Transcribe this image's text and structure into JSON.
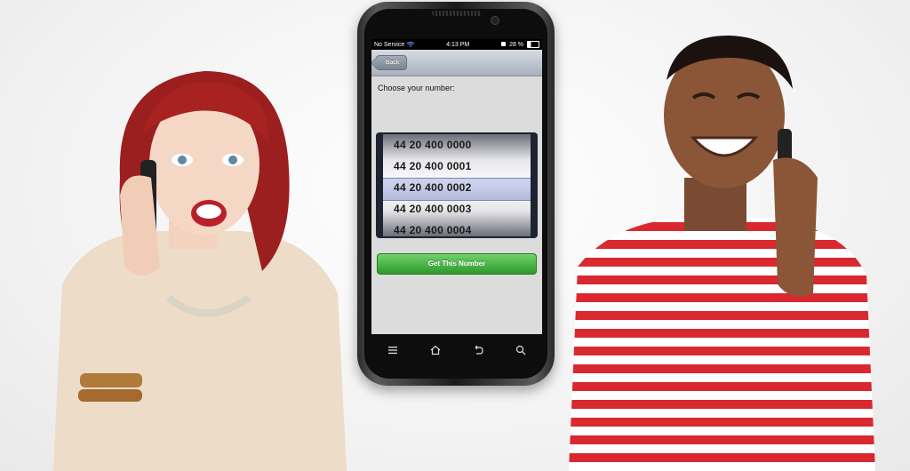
{
  "status_bar": {
    "carrier": "No Service",
    "time": "4:13 PM",
    "battery": "28 %"
  },
  "nav": {
    "back_label": "Back"
  },
  "prompt": "Choose your number:",
  "numbers": [
    "44 20 400 0000",
    "44 20 400 0001",
    "44 20 400 0002",
    "44 20 400 0003",
    "44 20 400 0004"
  ],
  "selected_index": 2,
  "action_button": "Get This Number",
  "colors": {
    "action_green": "#3aa836",
    "status_bar": "#000000",
    "nav_bar": "#b7bdc7",
    "woman_hair": "#a01e1e",
    "man_shirt_stripe": "#d9282f"
  },
  "softkey_icons": [
    "menu-icon",
    "home-icon",
    "back-arrow-icon",
    "search-icon"
  ]
}
